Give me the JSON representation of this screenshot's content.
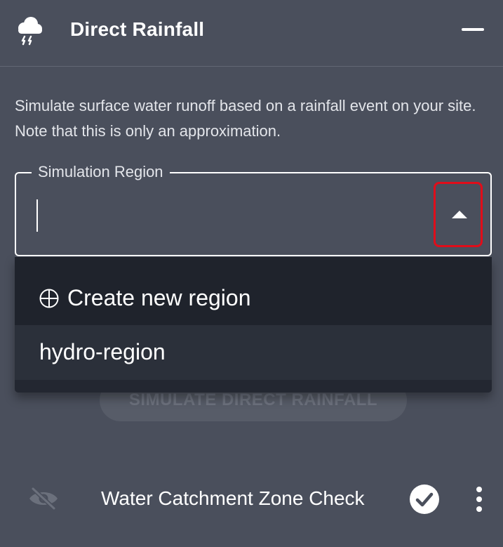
{
  "header": {
    "title": "Direct Rainfall",
    "icon": "storm-cloud-icon"
  },
  "description": "Simulate surface water runoff based on a rainfall event on your site. Note that this is only an approximation.",
  "region_field": {
    "label": "Simulation Region",
    "value": "",
    "placeholder": ""
  },
  "dropdown": {
    "options": [
      {
        "icon": "plus-circle-icon",
        "label": "Create new region"
      },
      {
        "label": "hydro-region"
      }
    ]
  },
  "simulate_button": {
    "label": "SIMULATE DIRECT RAINFALL"
  },
  "layer": {
    "name": "Water Catchment Zone Check",
    "visibility_icon": "eye-off-icon",
    "status_icon": "check-circle-icon",
    "menu_icon": "more-vertical-icon"
  },
  "colors": {
    "panel_bg": "#4a4f5c",
    "menu_bg": "#232731",
    "highlight_border": "#e00d1a",
    "text": "#ffffff"
  }
}
